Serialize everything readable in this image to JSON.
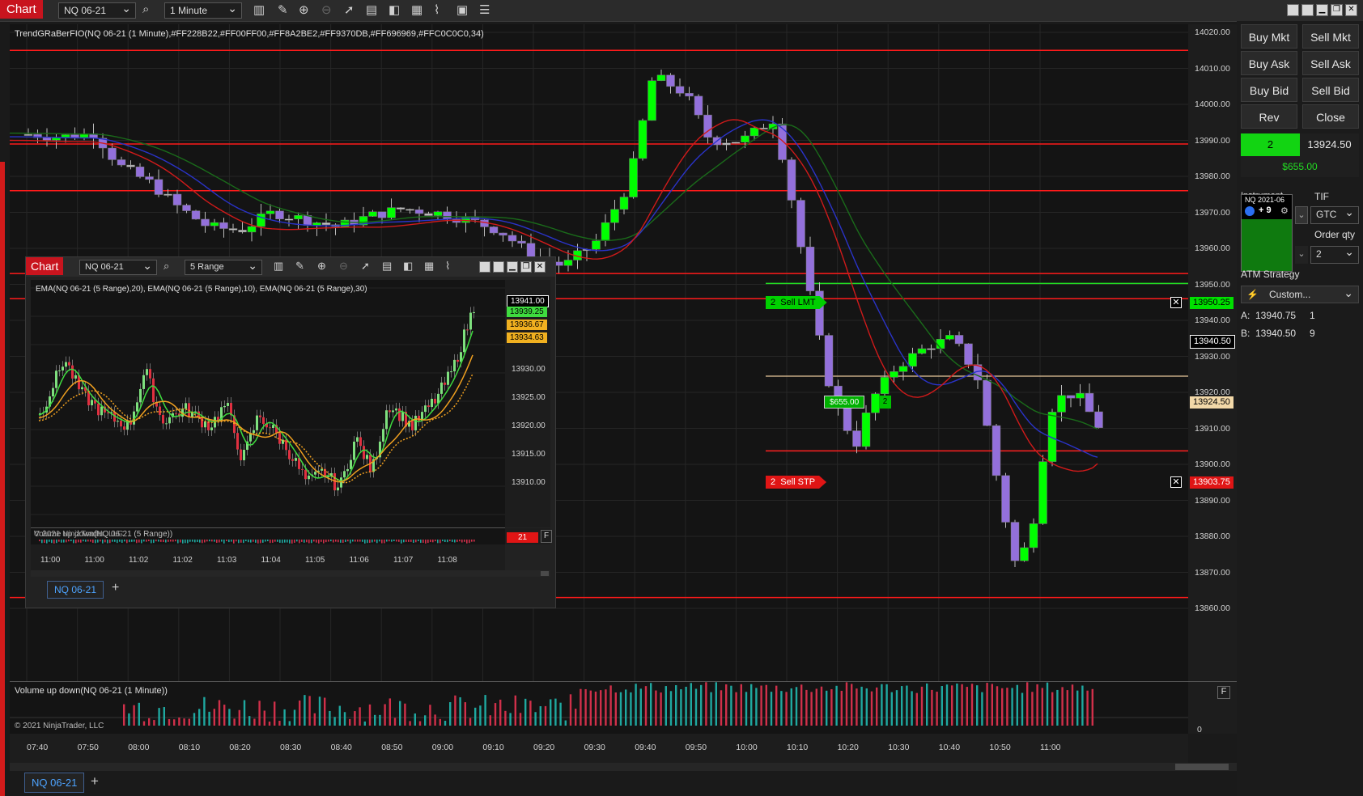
{
  "main": {
    "title_tab": "Chart",
    "instrument": "NQ 06-21",
    "interval": "1 Minute",
    "indicator_label": "TrendGRaBerFIO(NQ 06-21 (1 Minute),#FF228B22,#FF00FF00,#FF8A2BE2,#FF9370DB,#FF696969,#FFC0C0C0,34)",
    "volume_label": "Volume up down(NQ 06-21 (1 Minute))",
    "copyright": "© 2021 NinjaTrader, LLC",
    "volume_zero": "0",
    "volume_f": "F",
    "price_ticks": [
      "14020.00",
      "14010.00",
      "14000.00",
      "13990.00",
      "13980.00",
      "13970.00",
      "13960.00",
      "13950.00",
      "13940.00",
      "13930.00",
      "13920.00",
      "13910.00",
      "13900.00",
      "13890.00",
      "13880.00",
      "13870.00",
      "13860.00"
    ],
    "time_ticks": [
      "07:40",
      "07:50",
      "08:00",
      "08:10",
      "08:20",
      "08:30",
      "08:40",
      "08:50",
      "09:00",
      "09:10",
      "09:20",
      "09:30",
      "09:40",
      "09:50",
      "10:00",
      "10:10",
      "10:20",
      "10:30",
      "10:40",
      "10:50",
      "11:00"
    ],
    "tags": {
      "sell_lmt_price": "13950.25",
      "last_price": "13940.50",
      "avg_price": "13924.50",
      "sell_stp_price": "13903.75"
    },
    "orders": {
      "sell_lmt_label": "Sell LMT",
      "sell_lmt_qty": "2",
      "sell_stp_label": "Sell STP",
      "sell_stp_qty": "2",
      "position_pnl": "$655.00",
      "position_qty": "2"
    },
    "bottom_tab": "NQ 06-21",
    "add_tab": "+",
    "colors": {
      "up": "#00ff00",
      "down": "#9370db",
      "neutral": "#c0c0c0",
      "level": "#ff1a1a"
    }
  },
  "sub": {
    "title_tab": "Chart",
    "instrument": "NQ 06-21",
    "interval": "5 Range",
    "indicator_label": "EMA(NQ 06-21 (5 Range),20), EMA(NQ 06-21 (5 Range),10), EMA(NQ 06-21 (5 Range),30)",
    "volume_label": "Volume up down(NQ 06-21 (5 Range))",
    "copyright": "© 2021 NinjaTrader, LLC",
    "price_ticks": [
      "13930.00",
      "13925.00",
      "13920.00",
      "13915.00",
      "13910.00"
    ],
    "tags": [
      "13941.00",
      "13939.25",
      "13936.67",
      "13934.63"
    ],
    "volume_tag": "21",
    "volume_f": "F",
    "time_ticks": [
      "11:00",
      "11:00",
      "11:02",
      "11:02",
      "11:03",
      "11:04",
      "11:05",
      "11:06",
      "11:07",
      "11:08"
    ],
    "bottom_tab": "NQ 06-21",
    "add_tab": "+"
  },
  "order_panel": {
    "buttons": [
      "Buy Mkt",
      "Sell Mkt",
      "Buy Ask",
      "Sell Ask",
      "Buy Bid",
      "Sell Bid",
      "Rev",
      "Close"
    ],
    "position_qty": "2",
    "position_price": "13924.50",
    "unrealized": "$655.00",
    "instrument_label": "Instrument",
    "tif_label": "TIF",
    "tif_value": "GTC",
    "order_qty_label": "Order qty",
    "order_qty_value": "2",
    "popup_title": "NQ 2021-06",
    "popup_value": "+ 9",
    "atm_label": "ATM Strategy",
    "atm_value": "Custom...",
    "ask_label": "A:",
    "ask_price": "13940.75",
    "ask_size": "1",
    "bid_label": "B:",
    "bid_price": "13940.50",
    "bid_size": "9"
  }
}
